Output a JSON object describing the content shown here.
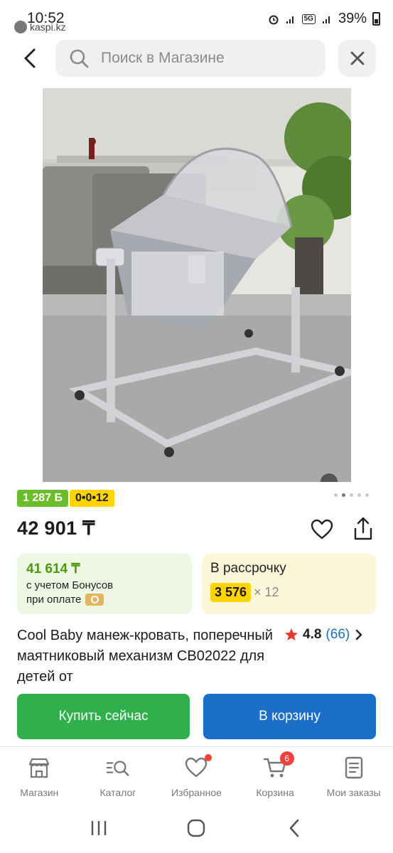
{
  "status_bar": {
    "time": "10:52",
    "app": "kaspi.kz",
    "network": "5G",
    "battery": "39%"
  },
  "search": {
    "placeholder": "Поиск в Магазине",
    "value": ""
  },
  "product": {
    "image_icon": "bassinet-photo",
    "bonus_badge": "1 287 Б",
    "installment_badge": "0•0•12",
    "price": "42 901 ₸",
    "bonus_card": {
      "amount": "41 614 ₸",
      "line1": "с учетом Бонусов",
      "line2": "при оплате"
    },
    "installment_card": {
      "title": "В рассрочку",
      "monthly": "3 576",
      "times": "× 12"
    },
    "title": "Cool Baby манеж-кровать, поперечный маятниковый механизм CB02022 для детей от",
    "rating": {
      "score": "4.8",
      "count": "(66)"
    },
    "image_pages": 5,
    "active_page": 2
  },
  "actions": {
    "buy_now": "Купить сейчас",
    "add_to_cart": "В корзину"
  },
  "tabbar": {
    "items": [
      {
        "label": "Магазин",
        "icon": "shop-icon"
      },
      {
        "label": "Каталог",
        "icon": "catalog-icon"
      },
      {
        "label": "Избранное",
        "icon": "heart-icon",
        "dot": true
      },
      {
        "label": "Корзина",
        "icon": "cart-icon",
        "badge": "6"
      },
      {
        "label": "Мои заказы",
        "icon": "orders-icon"
      }
    ]
  },
  "colors": {
    "bonus_green": "#6cbd2c",
    "install_yellow": "#ffd400",
    "buy_green": "#2fb04d",
    "cart_blue": "#1b6fc8",
    "badge_red": "#f0413a"
  }
}
